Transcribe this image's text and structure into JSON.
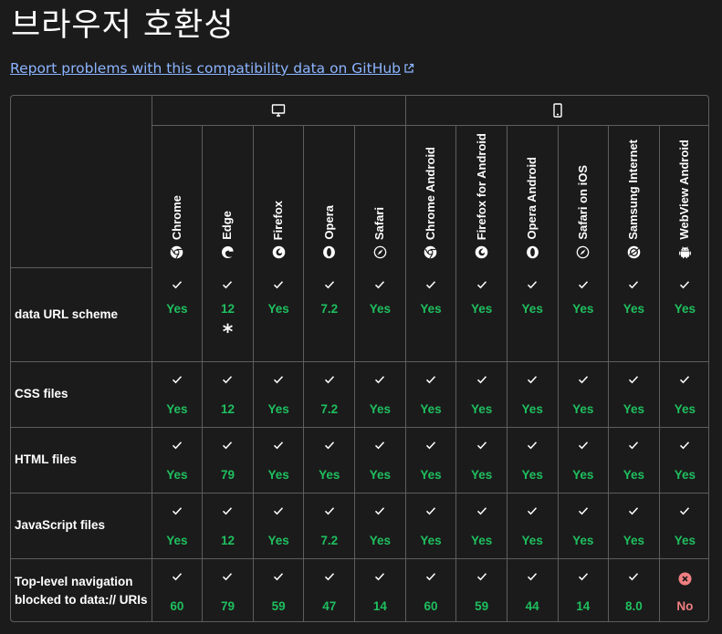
{
  "title": "브라우저 호환성",
  "report_link": "Report problems with this compatibility data on GitHub",
  "platforms": [
    {
      "name": "desktop",
      "icon": "desktop-icon"
    },
    {
      "name": "mobile",
      "icon": "mobile-icon"
    }
  ],
  "browsers": [
    {
      "name": "Chrome",
      "icon": "chrome-icon"
    },
    {
      "name": "Edge",
      "icon": "edge-icon"
    },
    {
      "name": "Firefox",
      "icon": "firefox-icon"
    },
    {
      "name": "Opera",
      "icon": "opera-icon"
    },
    {
      "name": "Safari",
      "icon": "safari-icon"
    },
    {
      "name": "Chrome Android",
      "icon": "chrome-icon"
    },
    {
      "name": "Firefox for Android",
      "icon": "firefox-icon"
    },
    {
      "name": "Opera Android",
      "icon": "opera-icon"
    },
    {
      "name": "Safari on iOS",
      "icon": "safari-icon"
    },
    {
      "name": "Samsung Internet",
      "icon": "samsung-internet-icon"
    },
    {
      "name": "WebView Android",
      "icon": "android-icon"
    }
  ],
  "features": [
    {
      "name": "data URL scheme",
      "support": [
        "Yes",
        "12",
        "Yes",
        "7.2",
        "Yes",
        "Yes",
        "Yes",
        "Yes",
        "Yes",
        "Yes",
        "Yes"
      ],
      "status": [
        "yes",
        "yes",
        "yes",
        "yes",
        "yes",
        "yes",
        "yes",
        "yes",
        "yes",
        "yes",
        "yes"
      ],
      "note": {
        "column": 1,
        "mark": "*"
      }
    },
    {
      "name": "CSS files",
      "support": [
        "Yes",
        "12",
        "Yes",
        "7.2",
        "Yes",
        "Yes",
        "Yes",
        "Yes",
        "Yes",
        "Yes",
        "Yes"
      ],
      "status": [
        "yes",
        "yes",
        "yes",
        "yes",
        "yes",
        "yes",
        "yes",
        "yes",
        "yes",
        "yes",
        "yes"
      ]
    },
    {
      "name": "HTML files",
      "support": [
        "Yes",
        "79",
        "Yes",
        "Yes",
        "Yes",
        "Yes",
        "Yes",
        "Yes",
        "Yes",
        "Yes",
        "Yes"
      ],
      "status": [
        "yes",
        "yes",
        "yes",
        "yes",
        "yes",
        "yes",
        "yes",
        "yes",
        "yes",
        "yes",
        "yes"
      ]
    },
    {
      "name": "JavaScript files",
      "support": [
        "Yes",
        "12",
        "Yes",
        "7.2",
        "Yes",
        "Yes",
        "Yes",
        "Yes",
        "Yes",
        "Yes",
        "Yes"
      ],
      "status": [
        "yes",
        "yes",
        "yes",
        "yes",
        "yes",
        "yes",
        "yes",
        "yes",
        "yes",
        "yes",
        "yes"
      ]
    },
    {
      "name": "Top-level navigation blocked to data:// URIs",
      "support": [
        "60",
        "79",
        "59",
        "47",
        "14",
        "60",
        "59",
        "44",
        "14",
        "8.0",
        "No"
      ],
      "status": [
        "yes",
        "yes",
        "yes",
        "yes",
        "yes",
        "yes",
        "yes",
        "yes",
        "yes",
        "yes",
        "no"
      ]
    }
  ],
  "colors": {
    "yes": "#1fbf5f",
    "no": "#f07f82",
    "link": "#8cb4ff",
    "border": "#5e5e5e",
    "background": "#1b1b1b"
  }
}
